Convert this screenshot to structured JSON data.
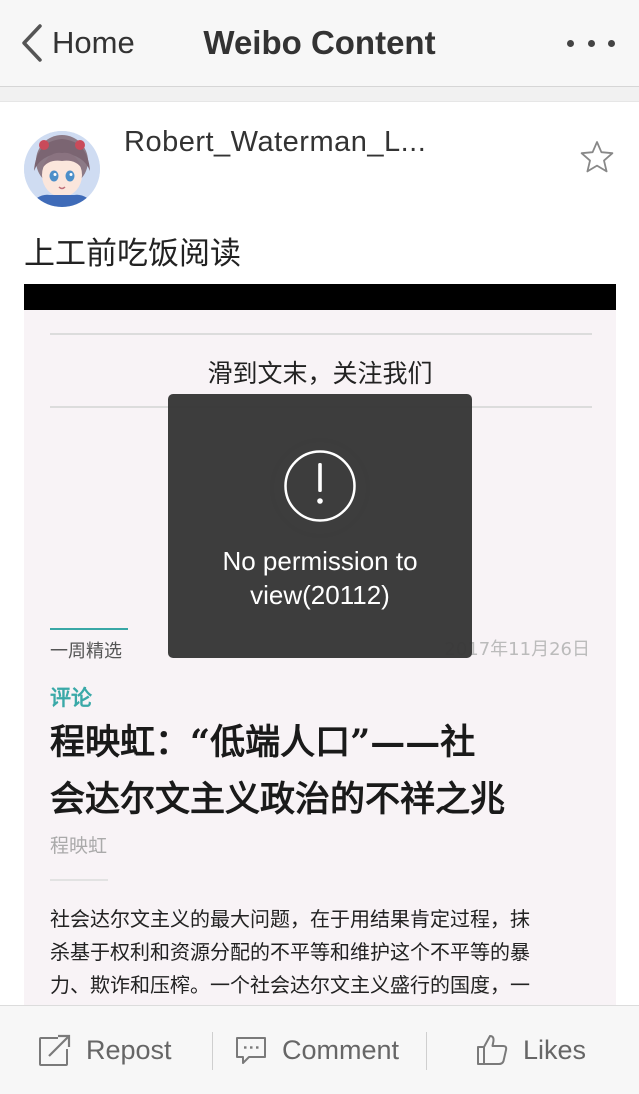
{
  "nav": {
    "back_label": "Home",
    "title": "Weibo Content"
  },
  "post": {
    "username": "Robert_Waterman_L...",
    "text": "上工前吃饭阅读"
  },
  "article_image": {
    "follow_prompt": "滑到文末，关注我们",
    "week_label": "一周精选",
    "date": "2017年11月26日",
    "category": "评论",
    "headline_line1": "程映虹：“低端人口”——社",
    "headline_line2": "会达尔文主义政治的不祥之兆",
    "author": "程映虹",
    "body_line1": "社会达尔文主义的最大问题，在于用结果肯定过程，抹",
    "body_line2": "杀基于权利和资源分配的不平等和维护这个不平等的暴",
    "body_line3": "力、欺诈和压榨。一个社会达尔文主义盛行的国度，一"
  },
  "toast": {
    "message": "No permission to view(20112)"
  },
  "toolbar": {
    "repost_label": "Repost",
    "comment_label": "Comment",
    "likes_label": "Likes"
  },
  "colors": {
    "accent_teal": "#3aa9a8",
    "toast_bg": "#373737",
    "icon_gray": "#7a7a7a"
  }
}
